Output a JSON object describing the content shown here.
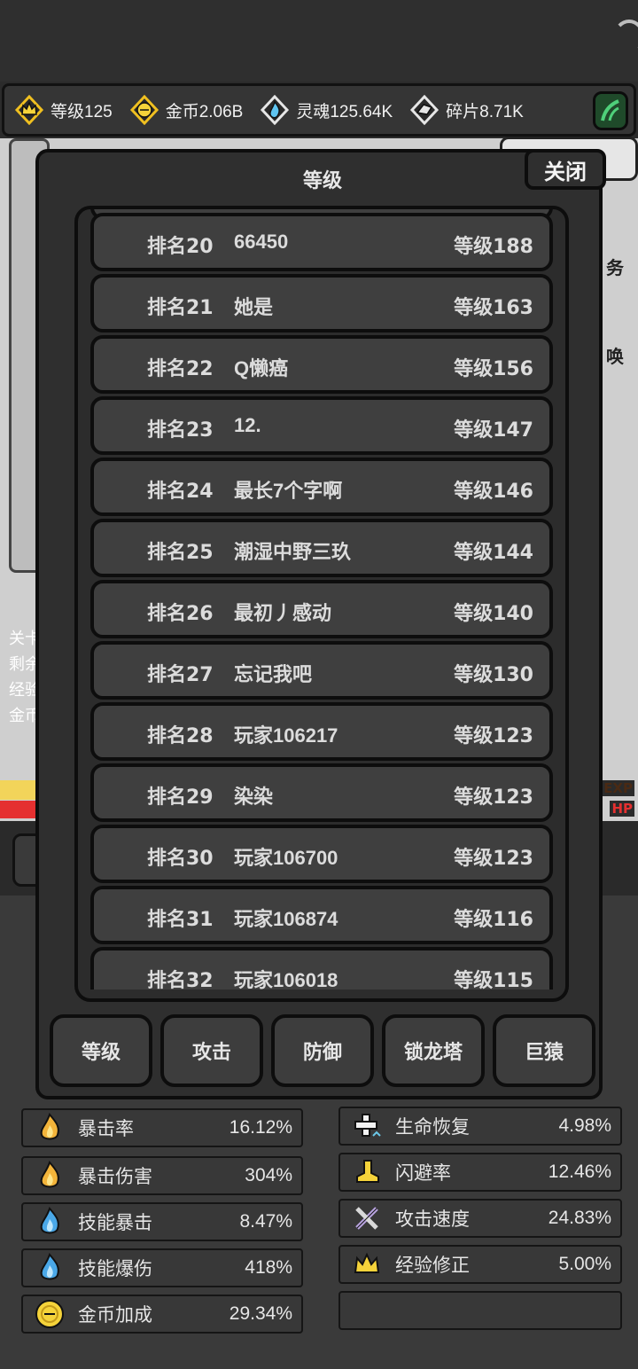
{
  "resources": [
    {
      "icon": "crown-icon",
      "text": "等级125"
    },
    {
      "icon": "gold-coin-icon",
      "text": "金币2.06B"
    },
    {
      "icon": "soul-flame-icon",
      "text": "灵魂125.64K"
    },
    {
      "icon": "fragment-icon",
      "text": "碎片8.71K"
    }
  ],
  "scene": {
    "side_text_1": "务",
    "side_text_2": "唤",
    "info_lines": [
      "关卡",
      "剩余",
      "经验",
      "金币"
    ],
    "exp_label": "EXP",
    "hp_label": "HP"
  },
  "modal": {
    "title": "等级",
    "close_label": "关闭",
    "rows": [
      {
        "rank": "排名20",
        "name": "66450",
        "level": "等级188"
      },
      {
        "rank": "排名21",
        "name": "她是",
        "level": "等级163"
      },
      {
        "rank": "排名22",
        "name": "Q懒癌",
        "level": "等级156"
      },
      {
        "rank": "排名23",
        "name": "12.",
        "level": "等级147"
      },
      {
        "rank": "排名24",
        "name": "最长7个字啊",
        "level": "等级146"
      },
      {
        "rank": "排名25",
        "name": "潮湿中野三玖",
        "level": "等级144"
      },
      {
        "rank": "排名26",
        "name": "最初丿感动",
        "level": "等级140"
      },
      {
        "rank": "排名27",
        "name": "忘记我吧",
        "level": "等级130"
      },
      {
        "rank": "排名28",
        "name": "玩家106217",
        "level": "等级123"
      },
      {
        "rank": "排名29",
        "name": "染染",
        "level": "等级123"
      },
      {
        "rank": "排名30",
        "name": "玩家106700",
        "level": "等级123"
      },
      {
        "rank": "排名31",
        "name": "玩家106874",
        "level": "等级116"
      },
      {
        "rank": "排名32",
        "name": "玩家106018",
        "level": "等级115"
      }
    ],
    "tabs": [
      "等级",
      "攻击",
      "防御",
      "锁龙塔",
      "巨猿"
    ]
  },
  "stats_left": [
    {
      "icon": "flame-icon",
      "name": "暴击率",
      "value": "16.12%"
    },
    {
      "icon": "flame-icon",
      "name": "暴击伤害",
      "value": "304%"
    },
    {
      "icon": "blue-flame-icon",
      "name": "技能暴击",
      "value": "8.47%"
    },
    {
      "icon": "blue-flame-icon",
      "name": "技能爆伤",
      "value": "418%"
    },
    {
      "icon": "gold-coin-icon",
      "name": "金币加成",
      "value": "29.34%"
    }
  ],
  "stats_right": [
    {
      "icon": "heal-cross-icon",
      "name": "生命恢复",
      "value": "4.98%"
    },
    {
      "icon": "boot-icon",
      "name": "闪避率",
      "value": "12.46%"
    },
    {
      "icon": "crossed-swords-icon",
      "name": "攻击速度",
      "value": "24.83%"
    },
    {
      "icon": "crown-icon",
      "name": "经验修正",
      "value": "5.00%"
    }
  ],
  "colors": {
    "exp": "#f2d45a",
    "hp": "#e53030",
    "panel": "#2f2f2f",
    "row": "#3f3f3f"
  }
}
